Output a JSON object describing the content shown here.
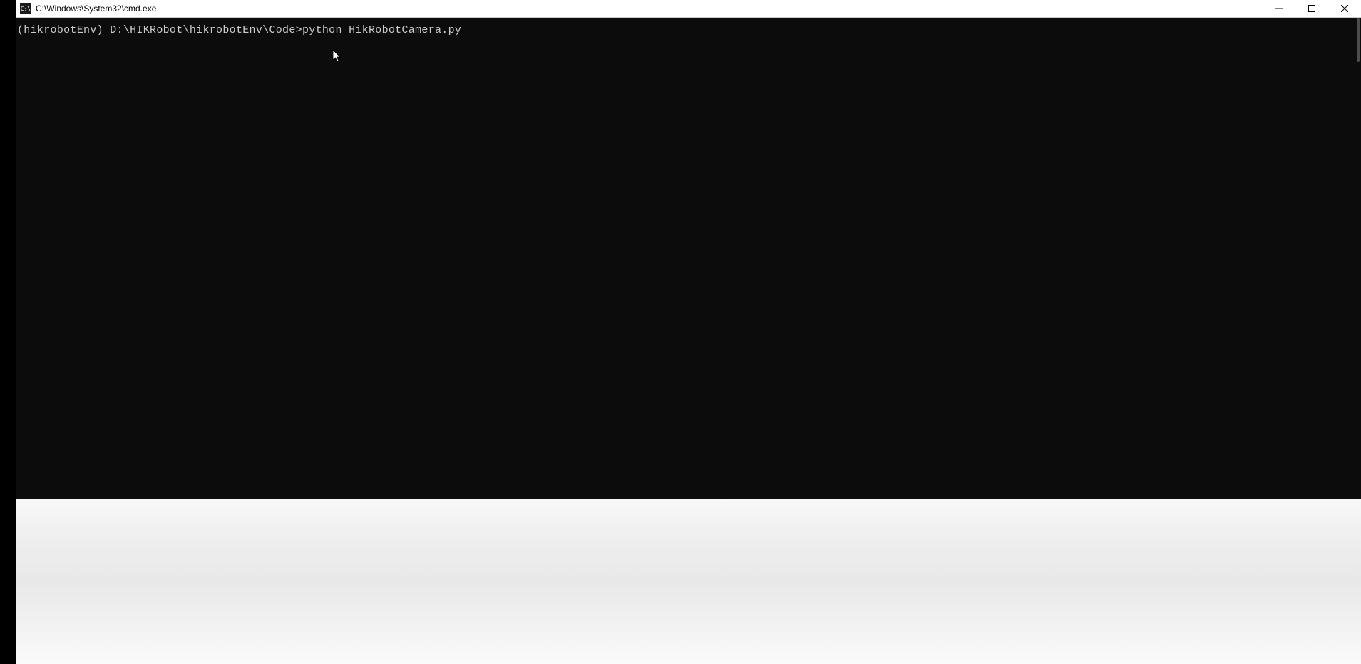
{
  "window": {
    "title": "C:\\Windows\\System32\\cmd.exe",
    "icon_label": "cmd-icon"
  },
  "terminal": {
    "prompt_line": "(hikrobotEnv) D:\\HIKRobot\\hikrobotEnv\\Code>python HikRobotCamera.py"
  },
  "controls": {
    "minimize": "minimize",
    "maximize": "maximize",
    "close": "close"
  }
}
